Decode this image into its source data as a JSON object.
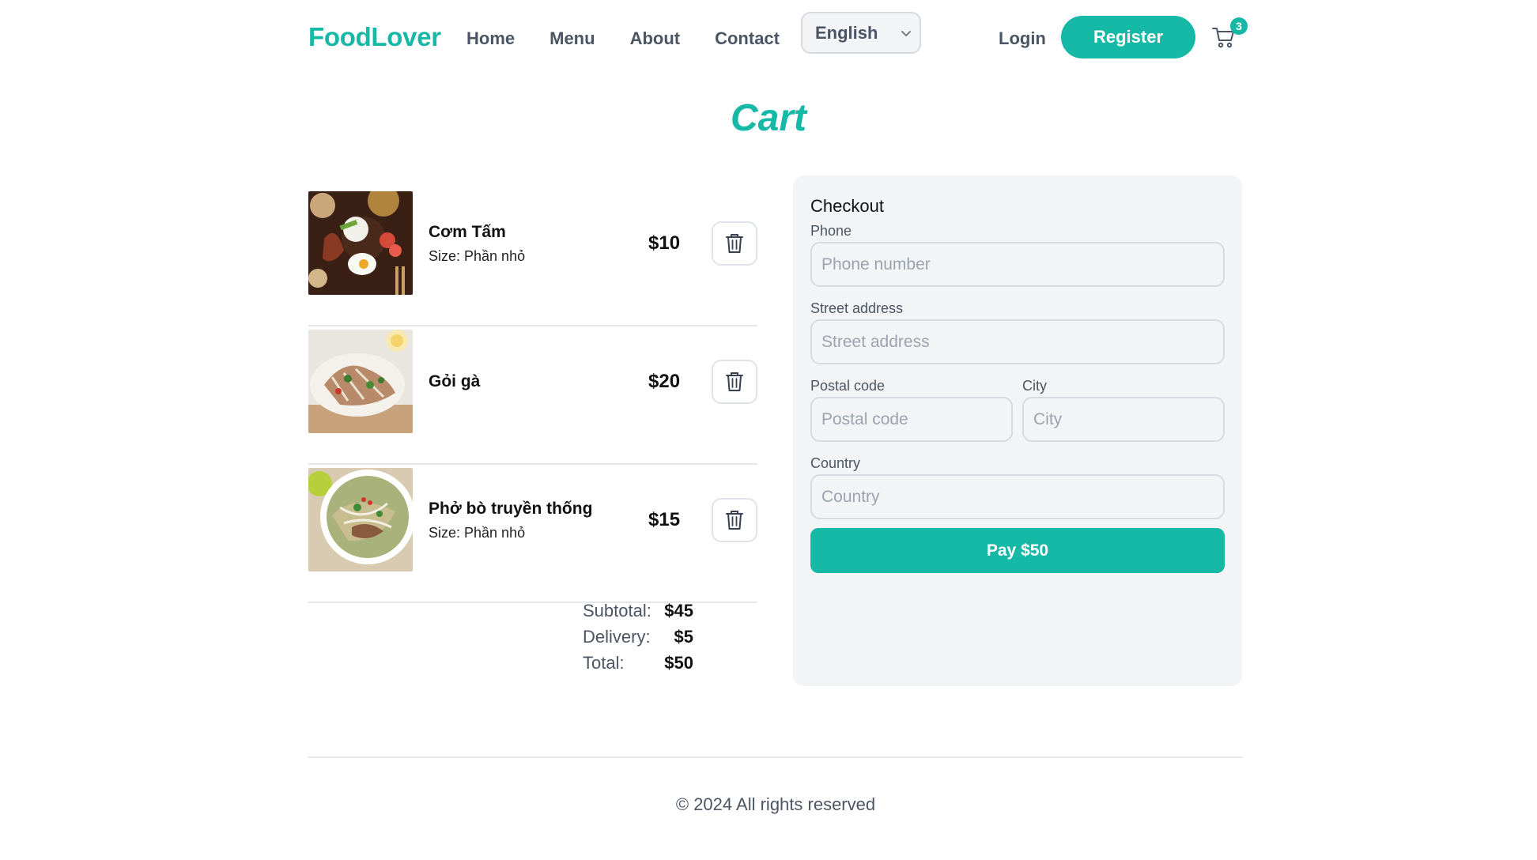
{
  "header": {
    "logo": "FoodLover",
    "nav": [
      "Home",
      "Menu",
      "About",
      "Contact"
    ],
    "language": {
      "selected": "English"
    },
    "login_label": "Login",
    "register_label": "Register",
    "cart_count": "3",
    "icons": {
      "cart": "cart-icon",
      "chevron": "chevron-down-icon"
    }
  },
  "page_title": "Cart",
  "cart": {
    "items": [
      {
        "name": "Cơm Tấm",
        "size": "Size: Phần nhỏ",
        "price": "$10",
        "image": "com-tam-photo"
      },
      {
        "name": "Gỏi gà",
        "size": "",
        "price": "$20",
        "image": "goi-ga-photo"
      },
      {
        "name": "Phở bò truyền thống",
        "size": "Size: Phần nhỏ",
        "price": "$15",
        "image": "pho-bo-photo"
      }
    ],
    "summary": {
      "subtotal_label": "Subtotal:",
      "subtotal": "$45",
      "delivery_label": "Delivery:",
      "delivery": "$5",
      "total_label": "Total:",
      "total": "$50"
    }
  },
  "checkout": {
    "title": "Checkout",
    "phone": {
      "label": "Phone",
      "placeholder": "Phone number",
      "value": ""
    },
    "street": {
      "label": "Street address",
      "placeholder": "Street address",
      "value": ""
    },
    "postal": {
      "label": "Postal code",
      "placeholder": "Postal code",
      "value": ""
    },
    "city": {
      "label": "City",
      "placeholder": "City",
      "value": ""
    },
    "country": {
      "label": "Country",
      "placeholder": "Country",
      "value": ""
    },
    "pay_label": "Pay $50"
  },
  "footer": {
    "text": "© 2024 All rights reserved"
  },
  "colors": {
    "accent": "#16b8a6",
    "panel": "#f3f4f6",
    "muted_text": "#4b5563"
  }
}
